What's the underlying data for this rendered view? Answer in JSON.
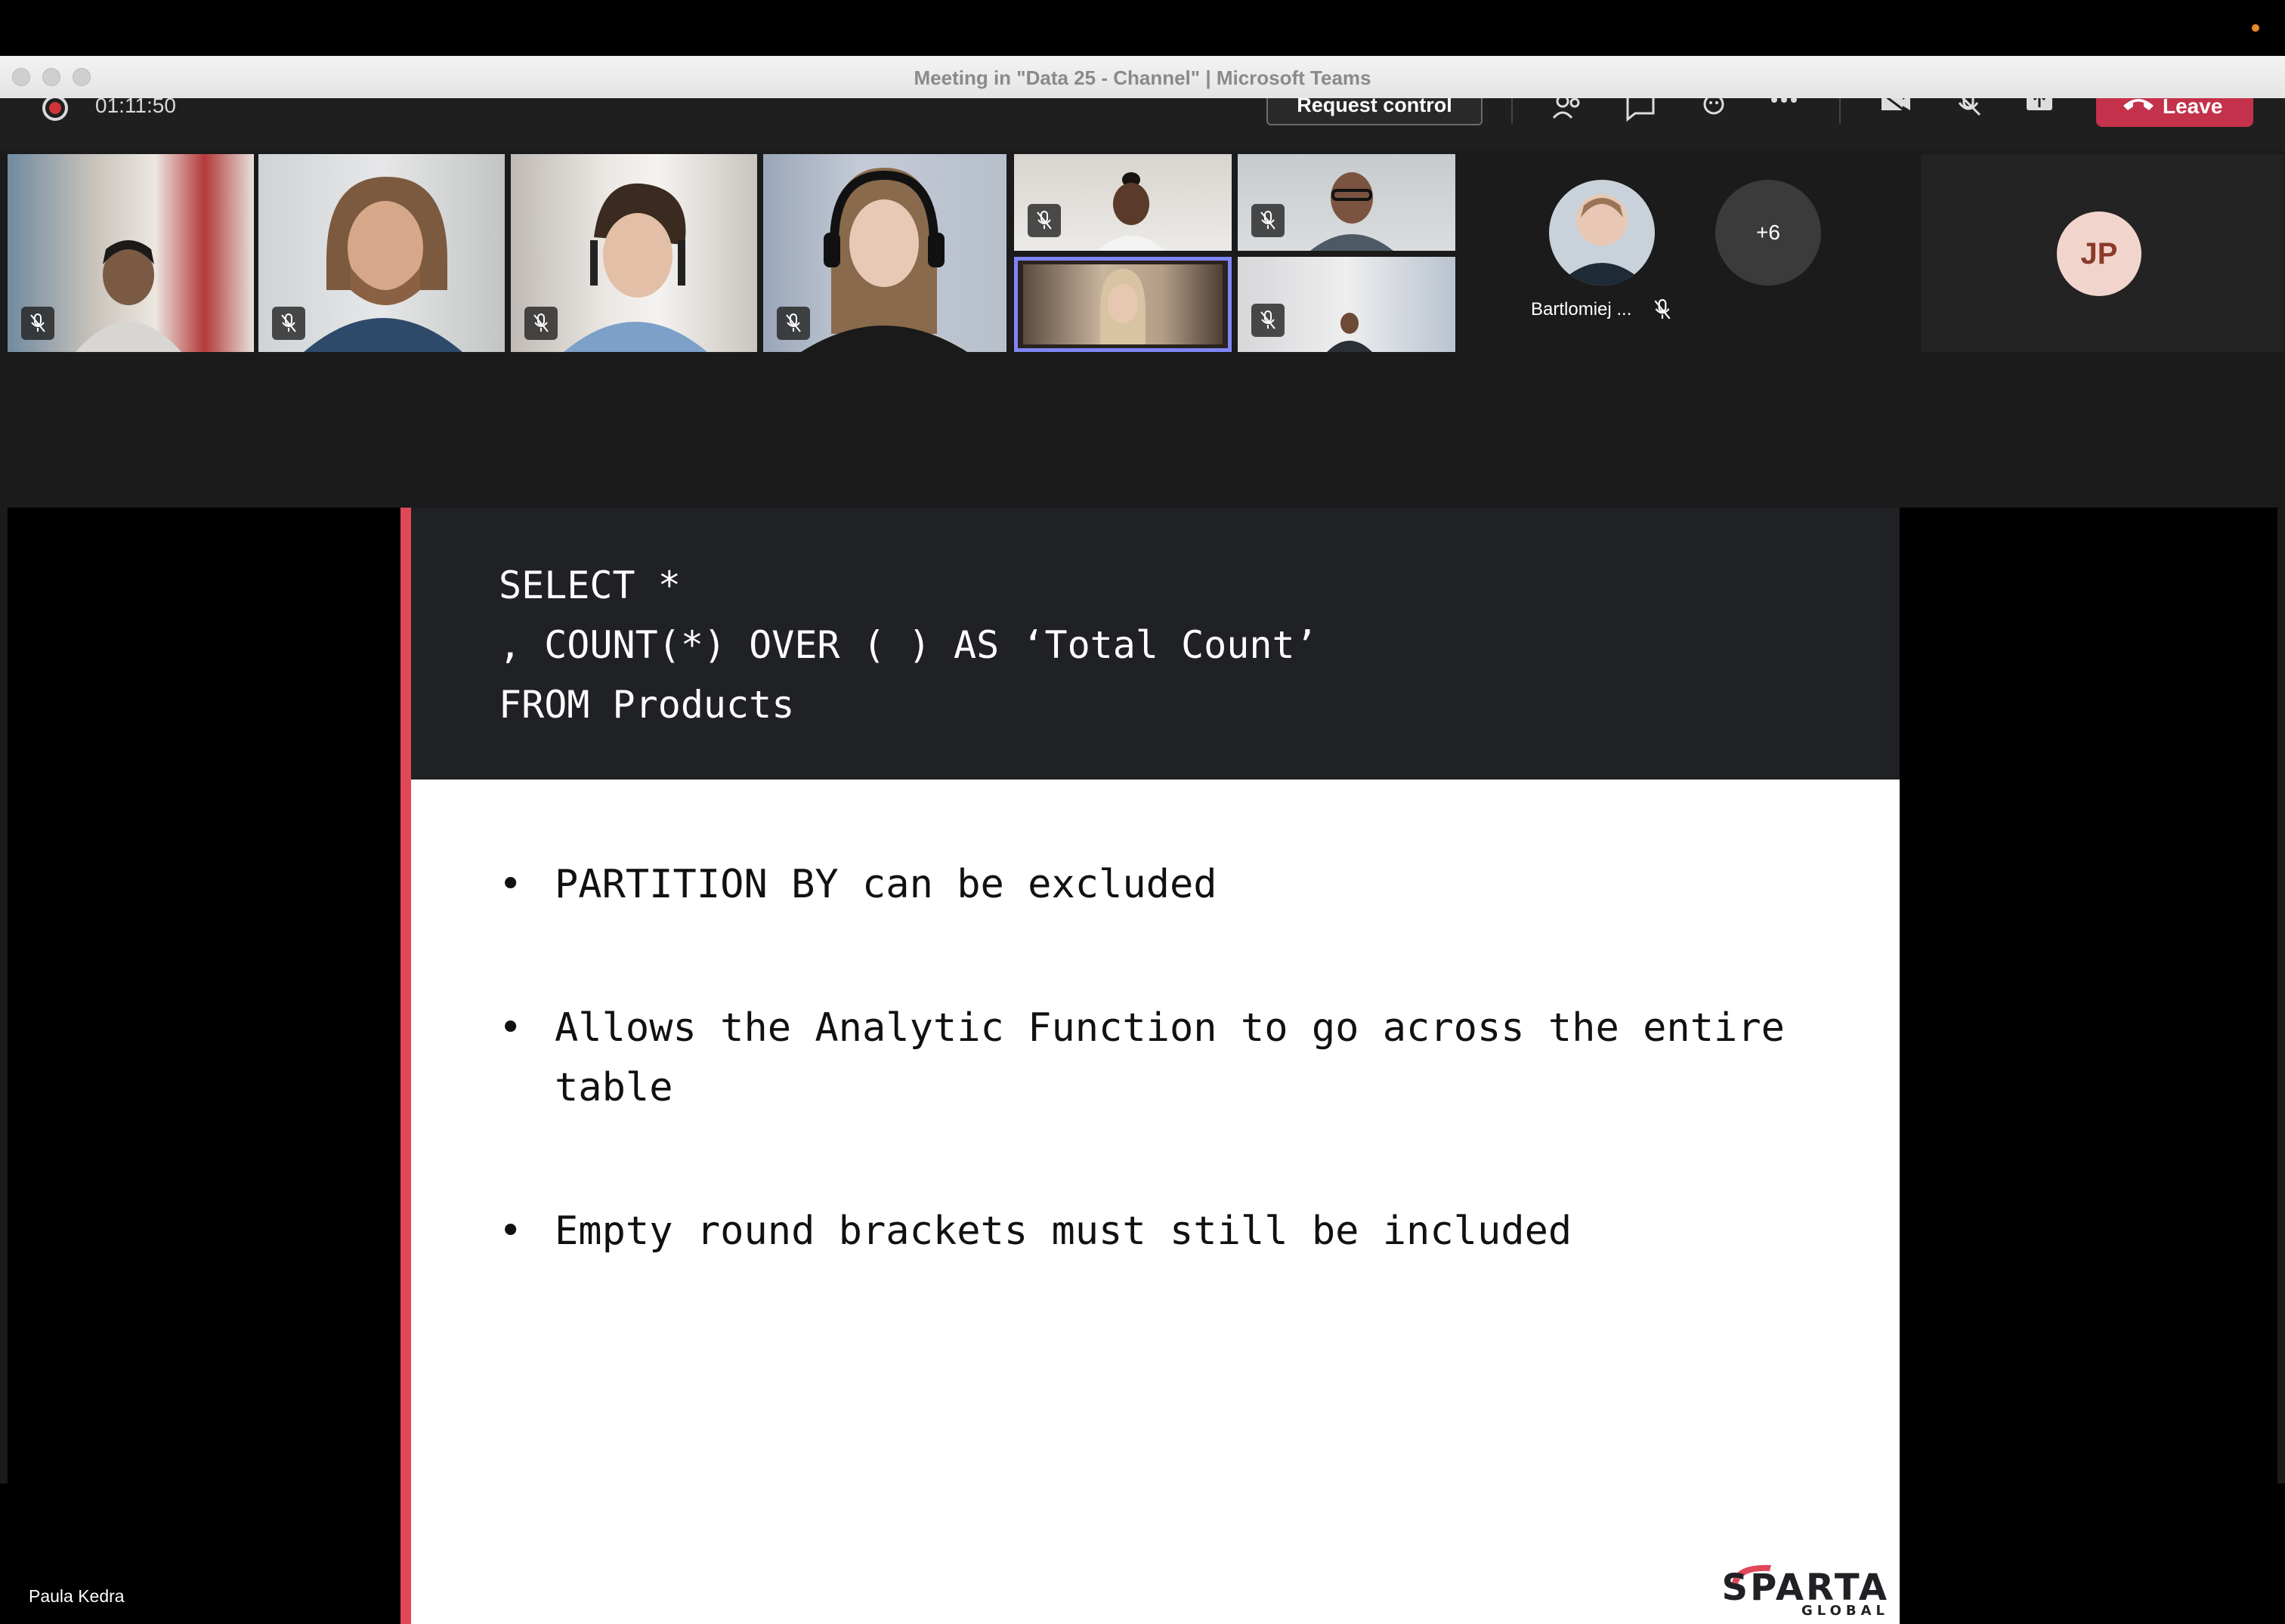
{
  "window": {
    "title": "Meeting in \"Data 25 - Channel\" | Microsoft Teams"
  },
  "toolbar": {
    "timer": "01:11:50",
    "request_control_label": "Request control",
    "leave_label": "Leave",
    "icons": [
      "people-icon",
      "chat-icon",
      "reactions-icon",
      "more-icon",
      "camera-off-icon",
      "mic-off-icon",
      "share-icon"
    ]
  },
  "participants": {
    "named": {
      "name": "Bartlomiej ..."
    },
    "more_count": "+6",
    "jp_initials": "JP"
  },
  "colors": {
    "accent": "#e0485a",
    "leave": "#c4314b",
    "selected": "#7f85f5",
    "slide_header": "#202125"
  },
  "presentation": {
    "presenter": "Paula Kedra",
    "code_lines": [
      "SELECT *",
      ", COUNT(*) OVER ( ) AS ‘Total Count’",
      "FROM Products"
    ],
    "bullets": [
      "PARTITION BY can be excluded",
      "Allows the Analytic Function to go across the entire table",
      "Empty round brackets must still be included"
    ],
    "bullet_symbol": "•",
    "logo": {
      "word": "SPARTA",
      "sub": "GLOBAL"
    }
  }
}
